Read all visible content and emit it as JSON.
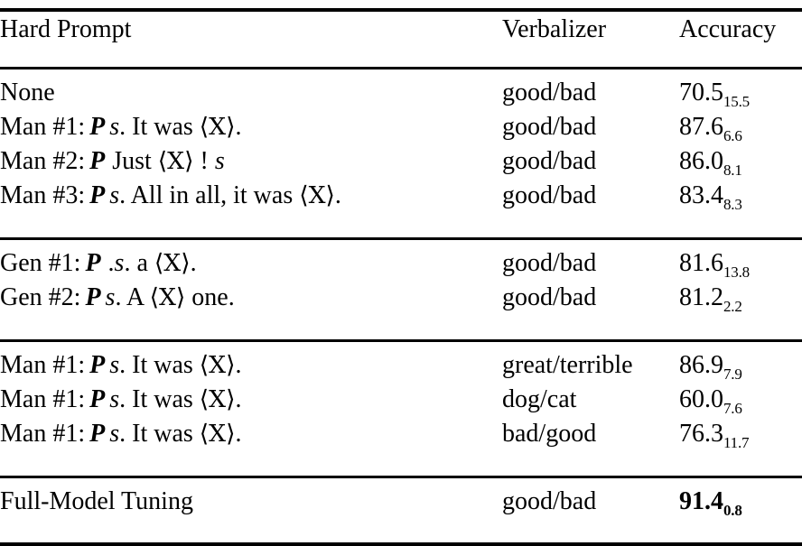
{
  "table": {
    "headers": {
      "prompt": "Hard Prompt",
      "verbalizer": "Verbalizer",
      "accuracy": "Accuracy"
    },
    "sections": [
      {
        "name": "manual-prompts",
        "rows": [
          {
            "prompt_plain": "None",
            "prompt_parts": [
              {
                "t": "None",
                "style": "plain"
              }
            ],
            "verbalizer": "good/bad",
            "accuracy": "70.5",
            "accuracy_sub": "15.5",
            "bold": false
          },
          {
            "prompt_plain": "Man #1: P s. It was ⟨X⟩.",
            "prompt_parts": [
              {
                "t": "Man #1:",
                "style": "plain"
              },
              {
                "t": " ",
                "style": "space"
              },
              {
                "t": "P",
                "style": "mathP"
              },
              {
                "t": " ",
                "style": "space"
              },
              {
                "t": "s",
                "style": "maths"
              },
              {
                "t": ". It was ",
                "style": "plain"
              },
              {
                "t": "⟨X⟩",
                "style": "angle"
              },
              {
                "t": ".",
                "style": "plain"
              }
            ],
            "verbalizer": "good/bad",
            "accuracy": "87.6",
            "accuracy_sub": "6.6",
            "bold": false
          },
          {
            "prompt_plain": "Man #2: P Just ⟨X⟩ ! s",
            "prompt_parts": [
              {
                "t": "Man #2:",
                "style": "plain"
              },
              {
                "t": " ",
                "style": "space"
              },
              {
                "t": "P",
                "style": "mathP"
              },
              {
                "t": " Just ",
                "style": "plain"
              },
              {
                "t": "⟨X⟩",
                "style": "angle"
              },
              {
                "t": " ! ",
                "style": "plain"
              },
              {
                "t": "s",
                "style": "maths"
              }
            ],
            "verbalizer": "good/bad",
            "accuracy": "86.0",
            "accuracy_sub": "8.1",
            "bold": false
          },
          {
            "prompt_plain": "Man #3: P s. All in all, it was ⟨X⟩.",
            "prompt_parts": [
              {
                "t": "Man #3:",
                "style": "plain"
              },
              {
                "t": " ",
                "style": "space"
              },
              {
                "t": "P",
                "style": "mathP"
              },
              {
                "t": " ",
                "style": "space"
              },
              {
                "t": "s",
                "style": "maths"
              },
              {
                "t": ". All in all, it was ",
                "style": "plain"
              },
              {
                "t": "⟨X⟩",
                "style": "angle"
              },
              {
                "t": ".",
                "style": "plain"
              }
            ],
            "verbalizer": "good/bad",
            "accuracy": "83.4",
            "accuracy_sub": "8.3",
            "bold": false
          }
        ]
      },
      {
        "name": "generated-prompts",
        "rows": [
          {
            "prompt_plain": "Gen #1: P .s. a ⟨X⟩.",
            "prompt_parts": [
              {
                "t": "Gen #1:",
                "style": "plain"
              },
              {
                "t": " ",
                "style": "space"
              },
              {
                "t": "P",
                "style": "mathP"
              },
              {
                "t": " .",
                "style": "plain"
              },
              {
                "t": "s",
                "style": "maths"
              },
              {
                "t": ". a ",
                "style": "plain"
              },
              {
                "t": "⟨X⟩",
                "style": "angle"
              },
              {
                "t": ".",
                "style": "plain"
              }
            ],
            "verbalizer": "good/bad",
            "accuracy": "81.6",
            "accuracy_sub": "13.8",
            "bold": false
          },
          {
            "prompt_plain": "Gen #2: P s.  A ⟨X⟩ one.",
            "prompt_parts": [
              {
                "t": "Gen #2:",
                "style": "plain"
              },
              {
                "t": " ",
                "style": "space"
              },
              {
                "t": "P",
                "style": "mathP"
              },
              {
                "t": " ",
                "style": "space"
              },
              {
                "t": "s",
                "style": "maths"
              },
              {
                "t": ".  A ",
                "style": "plain"
              },
              {
                "t": "⟨X⟩",
                "style": "angle"
              },
              {
                "t": " one.",
                "style": "plain"
              }
            ],
            "verbalizer": "good/bad",
            "accuracy": "81.2",
            "accuracy_sub": "2.2",
            "bold": false
          }
        ]
      },
      {
        "name": "verbalizer-ablation",
        "rows": [
          {
            "prompt_plain": "Man #1: P s.  It was ⟨X⟩.",
            "prompt_parts": [
              {
                "t": "Man #1:",
                "style": "plain"
              },
              {
                "t": " ",
                "style": "space"
              },
              {
                "t": "P",
                "style": "mathP"
              },
              {
                "t": " ",
                "style": "space"
              },
              {
                "t": "s",
                "style": "maths"
              },
              {
                "t": ".  It was ",
                "style": "plain"
              },
              {
                "t": "⟨X⟩",
                "style": "angle"
              },
              {
                "t": ".",
                "style": "plain"
              }
            ],
            "verbalizer": "great/terrible",
            "accuracy": "86.9",
            "accuracy_sub": "7.9",
            "bold": false
          },
          {
            "prompt_plain": "Man #1: P s.  It was ⟨X⟩.",
            "prompt_parts": [
              {
                "t": "Man #1:",
                "style": "plain"
              },
              {
                "t": " ",
                "style": "space"
              },
              {
                "t": "P",
                "style": "mathP"
              },
              {
                "t": " ",
                "style": "space"
              },
              {
                "t": "s",
                "style": "maths"
              },
              {
                "t": ".  It was ",
                "style": "plain"
              },
              {
                "t": "⟨X⟩",
                "style": "angle"
              },
              {
                "t": ".",
                "style": "plain"
              }
            ],
            "verbalizer": "dog/cat",
            "accuracy": "60.0",
            "accuracy_sub": "7.6",
            "bold": false
          },
          {
            "prompt_plain": "Man #1: P s.  It was ⟨X⟩.",
            "prompt_parts": [
              {
                "t": "Man #1:",
                "style": "plain"
              },
              {
                "t": " ",
                "style": "space"
              },
              {
                "t": "P",
                "style": "mathP"
              },
              {
                "t": " ",
                "style": "space"
              },
              {
                "t": "s",
                "style": "maths"
              },
              {
                "t": ".  It was ",
                "style": "plain"
              },
              {
                "t": "⟨X⟩",
                "style": "angle"
              },
              {
                "t": ".",
                "style": "plain"
              }
            ],
            "verbalizer": "bad/good",
            "accuracy": "76.3",
            "accuracy_sub": "11.7",
            "bold": false
          }
        ]
      },
      {
        "name": "full-model-tuning",
        "rows": [
          {
            "prompt_plain": "Full-Model Tuning",
            "prompt_parts": [
              {
                "t": "Full-Model Tuning",
                "style": "plain"
              }
            ],
            "verbalizer": "good/bad",
            "accuracy": "91.4",
            "accuracy_sub": "0.8",
            "bold": true
          }
        ]
      }
    ]
  },
  "colors": {
    "text": "#000000",
    "background": "#ffffff",
    "rule": "#000000"
  }
}
